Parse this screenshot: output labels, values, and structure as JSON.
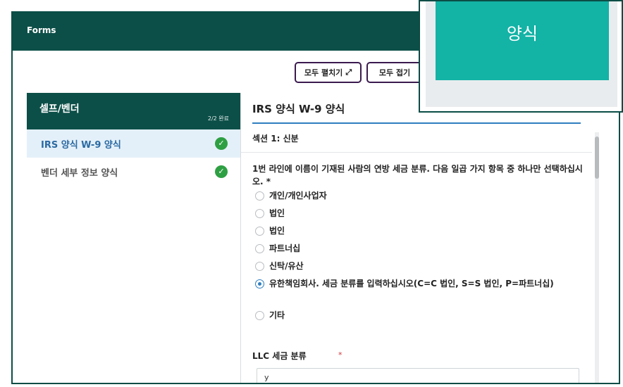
{
  "header": {
    "title": "Forms"
  },
  "toolbar": {
    "expand_label": "모두 펼치기",
    "expand_icon": "⤢",
    "collapse_label": "모두 접기"
  },
  "sidebar": {
    "title": "셀프/벤더",
    "count": "2/2 완료",
    "items": [
      {
        "label": "IRS 양식 W-9 양식",
        "status_icon": "check-circle-icon"
      },
      {
        "label": "벤더 세부 정보 양식",
        "status_icon": "check-circle-icon"
      }
    ]
  },
  "main": {
    "form_title": "IRS 양식 W-9 양식",
    "section": "섹션 1: 신분",
    "question": "1번 라인에 이름이 기재된 사람의 연방 세금 분류. 다음 일곱 가지 항목 중 하나만 선택하십시오. *",
    "options": [
      {
        "label": "개인/개인사업자",
        "selected": false
      },
      {
        "label": "법인",
        "selected": false
      },
      {
        "label": "법인",
        "selected": false
      },
      {
        "label": "파트너십",
        "selected": false
      },
      {
        "label": "신탁/유산",
        "selected": false
      },
      {
        "label": "유한책임회사. 세금 분류를 입력하십시오(C=C 법인, S=S 법인, P=파트너십)",
        "selected": true
      },
      {
        "label": "기타",
        "selected": false
      }
    ],
    "llc_label": "LLC 세금 분류",
    "llc_required": "*",
    "llc_value": "y"
  },
  "popup": {
    "label": "양식"
  },
  "colors": {
    "header": "#0c4f48",
    "accent": "#2f7fc1",
    "tile": "#13b3a6",
    "success": "#2ea043"
  }
}
